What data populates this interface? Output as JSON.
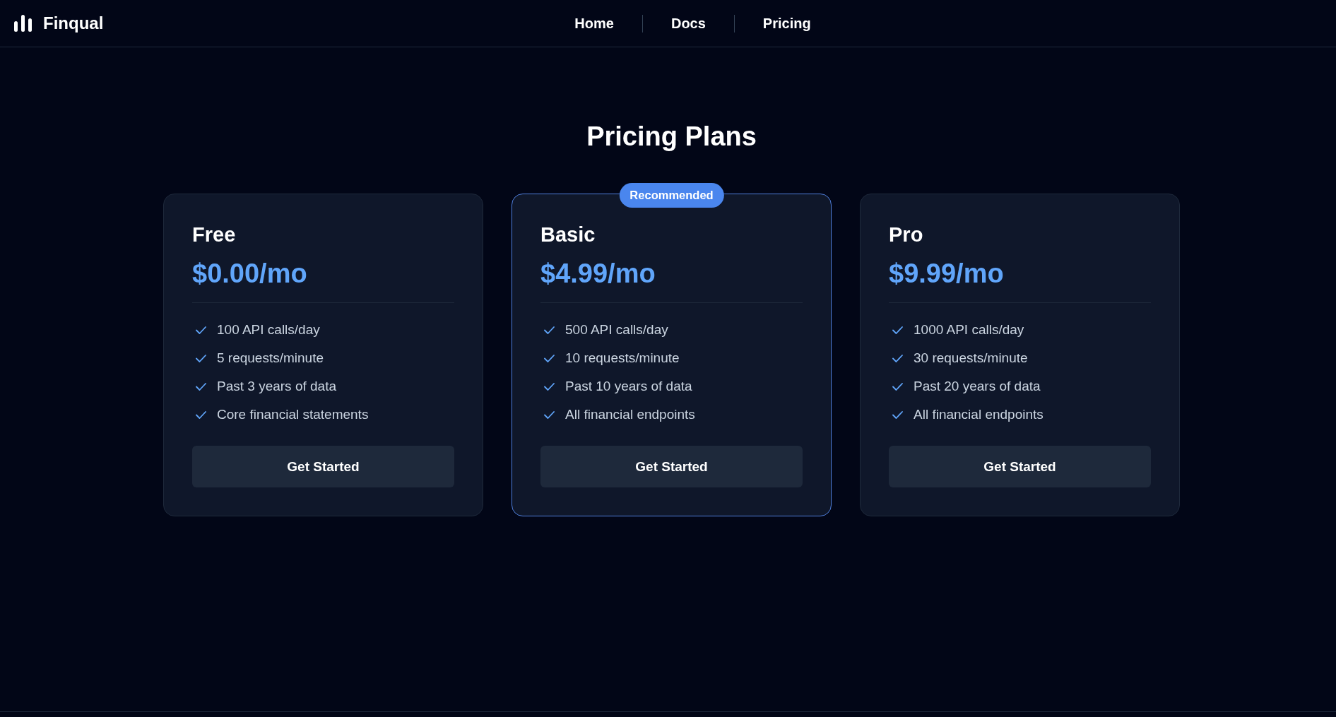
{
  "header": {
    "brand": "Finqual",
    "nav": [
      "Home",
      "Docs",
      "Pricing"
    ]
  },
  "title": "Pricing Plans",
  "plans": [
    {
      "name": "Free",
      "price": "$0.00/mo",
      "highlighted": false,
      "features": [
        "100 API calls/day",
        "5 requests/minute",
        "Past 3 years of data",
        "Core financial statements"
      ],
      "button": "Get Started"
    },
    {
      "name": "Basic",
      "badge": "Recommended",
      "price": "$4.99/mo",
      "highlighted": true,
      "features": [
        "500 API calls/day",
        "10 requests/minute",
        "Past 10 years of data",
        "All financial endpoints"
      ],
      "button": "Get Started"
    },
    {
      "name": "Pro",
      "price": "$9.99/mo",
      "highlighted": false,
      "features": [
        "1000 API calls/day",
        "30 requests/minute",
        "Past 20 years of data",
        "All financial endpoints"
      ],
      "button": "Get Started"
    }
  ]
}
